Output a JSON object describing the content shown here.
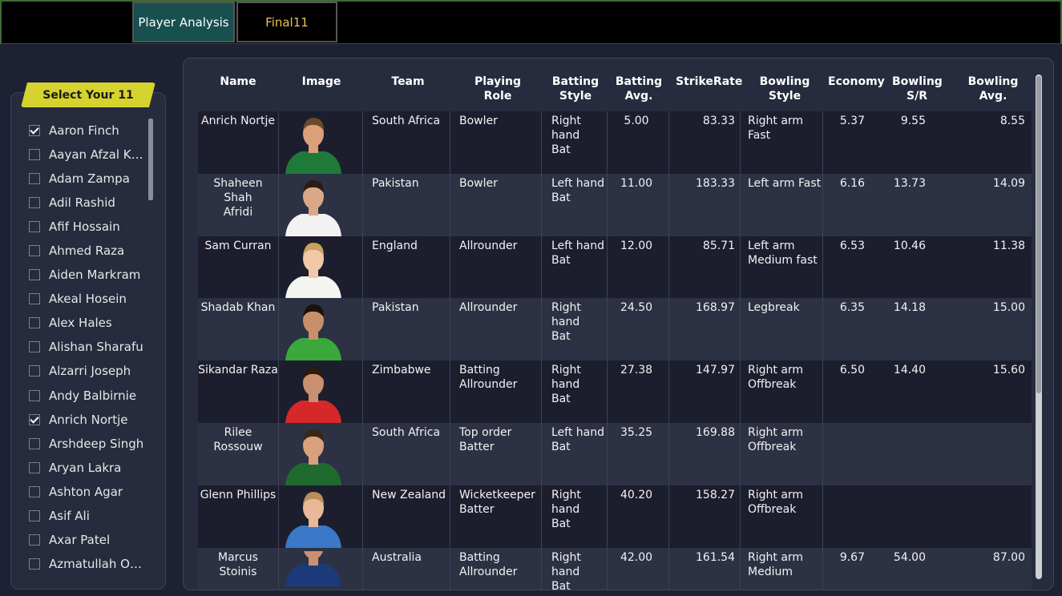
{
  "tabs": [
    {
      "label": "Player Analysis"
    },
    {
      "label": "Final11"
    }
  ],
  "selector": {
    "title": "Select Your 11",
    "players": [
      {
        "name": "Aaron Finch",
        "checked": true
      },
      {
        "name": "Aayan Afzal Khan",
        "checked": false
      },
      {
        "name": "Adam Zampa",
        "checked": false
      },
      {
        "name": "Adil Rashid",
        "checked": false
      },
      {
        "name": "Afif Hossain",
        "checked": false
      },
      {
        "name": "Ahmed Raza",
        "checked": false
      },
      {
        "name": "Aiden Markram",
        "checked": false
      },
      {
        "name": "Akeal Hosein",
        "checked": false
      },
      {
        "name": "Alex Hales",
        "checked": false
      },
      {
        "name": "Alishan Sharafu",
        "checked": false
      },
      {
        "name": "Alzarri Joseph",
        "checked": false
      },
      {
        "name": "Andy Balbirnie",
        "checked": false
      },
      {
        "name": "Anrich Nortje",
        "checked": true
      },
      {
        "name": "Arshdeep Singh",
        "checked": false
      },
      {
        "name": "Aryan Lakra",
        "checked": false
      },
      {
        "name": "Ashton Agar",
        "checked": false
      },
      {
        "name": "Asif Ali",
        "checked": false
      },
      {
        "name": "Axar Patel",
        "checked": false
      },
      {
        "name": "Azmatullah Oma...",
        "checked": false
      }
    ]
  },
  "table": {
    "headers": {
      "name": "Name",
      "image": "Image",
      "team": "Team",
      "role": "Playing Role",
      "batting_style_1": "Batting",
      "batting_style_2": "Style",
      "batting_avg_1": "Batting",
      "batting_avg_2": "Avg.",
      "strike_rate": "StrikeRate",
      "bowling_style": "Bowling Style",
      "economy": "Economy",
      "bowling_sr_1": "Bowling",
      "bowling_sr_2": "S/R",
      "bowling_avg": "Bowling Avg."
    },
    "sort": {
      "column": "Batting Avg.",
      "direction": "ascending"
    },
    "rows": [
      {
        "name": [
          "Anrich Nortje"
        ],
        "team": "South Africa",
        "role": [
          "Bowler"
        ],
        "bat_style": [
          "Right hand",
          "Bat"
        ],
        "bat_avg": "5.00",
        "strike_rate": "83.33",
        "bowl_style": [
          "Right arm",
          "Fast"
        ],
        "economy": "5.37",
        "bowl_sr": "9.55",
        "bowl_avg": "8.55",
        "jersey": "#1f7a3a",
        "skin": "#d9a07a",
        "hair": "#6b4a2a"
      },
      {
        "name": [
          "Shaheen Shah",
          "Afridi"
        ],
        "team": "Pakistan",
        "role": [
          "Bowler"
        ],
        "bat_style": [
          "Left hand",
          "Bat"
        ],
        "bat_avg": "11.00",
        "strike_rate": "183.33",
        "bowl_style": [
          "Left arm Fast"
        ],
        "economy": "6.16",
        "bowl_sr": "13.73",
        "bowl_avg": "14.09",
        "jersey": "#f2f2f2",
        "skin": "#d8a888",
        "hair": "#2a1c14"
      },
      {
        "name": [
          "Sam Curran"
        ],
        "team": "England",
        "role": [
          "Allrounder"
        ],
        "bat_style": [
          "Left hand",
          "Bat"
        ],
        "bat_avg": "12.00",
        "strike_rate": "85.71",
        "bowl_style": [
          "Left arm",
          "Medium fast"
        ],
        "economy": "6.53",
        "bowl_sr": "10.46",
        "bowl_avg": "11.38",
        "jersey": "#f5f5f0",
        "skin": "#f0c8a8",
        "hair": "#c9a35e"
      },
      {
        "name": [
          "Shadab Khan"
        ],
        "team": "Pakistan",
        "role": [
          "Allrounder"
        ],
        "bat_style": [
          "Right hand",
          "Bat"
        ],
        "bat_avg": "24.50",
        "strike_rate": "168.97",
        "bowl_style": [
          "Legbreak"
        ],
        "economy": "6.35",
        "bowl_sr": "14.18",
        "bowl_avg": "15.00",
        "jersey": "#3aa83a",
        "skin": "#c8906a",
        "hair": "#1a120c"
      },
      {
        "name": [
          "Sikandar Raza"
        ],
        "team": "Zimbabwe",
        "role": [
          "Batting",
          "Allrounder"
        ],
        "bat_style": [
          "Right hand",
          "Bat"
        ],
        "bat_avg": "27.38",
        "strike_rate": "147.97",
        "bowl_style": [
          "Right arm",
          "Offbreak"
        ],
        "economy": "6.50",
        "bowl_sr": "14.40",
        "bowl_avg": "15.60",
        "jersey": "#d62828",
        "skin": "#c89070",
        "hair": "#2a1a10"
      },
      {
        "name": [
          "Rilee Rossouw"
        ],
        "team": "South Africa",
        "role": [
          "Top order",
          "Batter"
        ],
        "bat_style": [
          "Left hand",
          "Bat"
        ],
        "bat_avg": "35.25",
        "strike_rate": "169.88",
        "bowl_style": [
          "Right arm",
          "Offbreak"
        ],
        "economy": "",
        "bowl_sr": "",
        "bowl_avg": "",
        "jersey": "#1f6a2f",
        "skin": "#d8a07c",
        "hair": "#3a2616"
      },
      {
        "name": [
          "Glenn Phillips"
        ],
        "team": "New Zealand",
        "role": [
          "Wicketkeeper",
          "Batter"
        ],
        "bat_style": [
          "Right hand",
          "Bat"
        ],
        "bat_avg": "40.20",
        "strike_rate": "158.27",
        "bowl_style": [
          "Right arm",
          "Offbreak"
        ],
        "economy": "",
        "bowl_sr": "",
        "bowl_avg": "",
        "jersey": "#3a78c8",
        "skin": "#e8b898",
        "hair": "#b8905a"
      },
      {
        "name": [
          "Marcus Stoinis"
        ],
        "team": "Australia",
        "role": [
          "Batting",
          "Allrounder"
        ],
        "bat_style": [
          "Right hand",
          "Bat"
        ],
        "bat_avg": "42.00",
        "strike_rate": "161.54",
        "bowl_style": [
          "Right arm",
          "Medium"
        ],
        "economy": "9.67",
        "bowl_sr": "54.00",
        "bowl_avg": "87.00",
        "jersey": "#1a3a7a",
        "skin": "#c89070",
        "hair": "#1c140e"
      }
    ]
  }
}
